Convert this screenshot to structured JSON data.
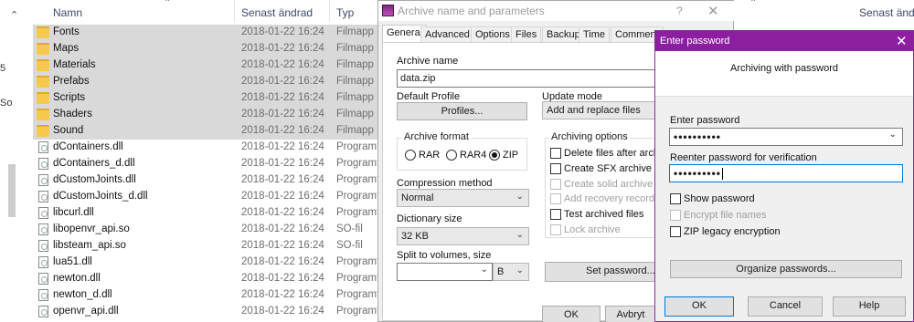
{
  "explorer": {
    "columns": {
      "name": "Namn",
      "modified": "Senast ändrad",
      "type": "Typ"
    },
    "right_column_header": "Senast ändrad",
    "left_nav": {
      "text1": "5",
      "text2": "So"
    },
    "rows": [
      {
        "name": "Fonts",
        "date": "2018-01-22 16:24",
        "type": "Filmapp",
        "kind": "folder",
        "selected": true
      },
      {
        "name": "Maps",
        "date": "2018-01-22 16:24",
        "type": "Filmapp",
        "kind": "folder",
        "selected": true
      },
      {
        "name": "Materials",
        "date": "2018-01-22 16:24",
        "type": "Filmapp",
        "kind": "folder",
        "selected": true
      },
      {
        "name": "Prefabs",
        "date": "2018-01-22 16:24",
        "type": "Filmapp",
        "kind": "folder",
        "selected": true
      },
      {
        "name": "Scripts",
        "date": "2018-01-22 16:24",
        "type": "Filmapp",
        "kind": "folder",
        "selected": true
      },
      {
        "name": "Shaders",
        "date": "2018-01-22 16:24",
        "type": "Filmapp",
        "kind": "folder",
        "selected": true
      },
      {
        "name": "Sound",
        "date": "2018-01-22 16:24",
        "type": "Filmapp",
        "kind": "folder",
        "selected": true
      },
      {
        "name": "dContainers.dll",
        "date": "2018-01-22 16:24",
        "type": "Programti",
        "kind": "file",
        "selected": false
      },
      {
        "name": "dContainers_d.dll",
        "date": "2018-01-22 16:24",
        "type": "Programti",
        "kind": "file",
        "selected": false
      },
      {
        "name": "dCustomJoints.dll",
        "date": "2018-01-22 16:24",
        "type": "Programti",
        "kind": "file",
        "selected": false
      },
      {
        "name": "dCustomJoints_d.dll",
        "date": "2018-01-22 16:24",
        "type": "Programti",
        "kind": "file",
        "selected": false
      },
      {
        "name": "libcurl.dll",
        "date": "2018-01-22 16:24",
        "type": "Programti",
        "kind": "file",
        "selected": false
      },
      {
        "name": "libopenvr_api.so",
        "date": "2018-01-22 16:24",
        "type": "SO-fil",
        "kind": "file",
        "selected": false
      },
      {
        "name": "libsteam_api.so",
        "date": "2018-01-22 16:24",
        "type": "SO-fil",
        "kind": "file",
        "selected": false
      },
      {
        "name": "lua51.dll",
        "date": "2018-01-22 16:24",
        "type": "Programti",
        "kind": "file",
        "selected": false
      },
      {
        "name": "newton.dll",
        "date": "2018-01-22 16:24",
        "type": "Programti",
        "kind": "file",
        "selected": false
      },
      {
        "name": "newton_d.dll",
        "date": "2018-01-22 16:24",
        "type": "Programti",
        "kind": "file",
        "selected": false
      },
      {
        "name": "openvr_api.dll",
        "date": "2018-01-22 16:24",
        "type": "Programti",
        "kind": "file",
        "selected": false
      }
    ]
  },
  "archive_dialog": {
    "title": "Archive name and parameters",
    "help": "?",
    "close": "✕",
    "tabs": [
      "General",
      "Advanced",
      "Options",
      "Files",
      "Backup",
      "Time",
      "Comment"
    ],
    "active_tab": "General",
    "archive_name_label": "Archive name",
    "archive_name_value": "data.zip",
    "default_profile_label": "Default Profile",
    "profiles_button": "Profiles...",
    "update_mode_label": "Update mode",
    "update_mode_value": "Add and replace files",
    "archive_format_label": "Archive format",
    "formats": [
      {
        "label": "RAR",
        "checked": false
      },
      {
        "label": "RAR4",
        "checked": false
      },
      {
        "label": "ZIP",
        "checked": true
      }
    ],
    "compression_method_label": "Compression method",
    "compression_method_value": "Normal",
    "dictionary_size_label": "Dictionary size",
    "dictionary_size_value": "32 KB",
    "split_label": "Split to volumes, size",
    "split_value": "",
    "split_unit": "B",
    "archiving_options_label": "Archiving options",
    "options": [
      {
        "label": "Delete files after archiving",
        "checked": false,
        "disabled": false
      },
      {
        "label": "Create SFX archive",
        "checked": false,
        "disabled": false
      },
      {
        "label": "Create solid archive",
        "checked": false,
        "disabled": true
      },
      {
        "label": "Add recovery record",
        "checked": false,
        "disabled": true
      },
      {
        "label": "Test archived files",
        "checked": false,
        "disabled": false
      },
      {
        "label": "Lock archive",
        "checked": false,
        "disabled": true
      }
    ],
    "set_password_button": "Set password...",
    "ok_button": "OK",
    "cancel_button": "Avbryt"
  },
  "password_dialog": {
    "title": "Enter password",
    "close": "✕",
    "subtitle": "Archiving with password",
    "enter_label": "Enter password",
    "enter_value": "••••••••••",
    "reenter_label": "Reenter password for verification",
    "reenter_value": "••••••••••",
    "show_password": "Show password",
    "encrypt_names": "Encrypt file names",
    "zip_legacy": "ZIP legacy encryption",
    "organize_button": "Organize passwords...",
    "ok_button": "OK",
    "cancel_button": "Cancel",
    "help_button": "Help"
  }
}
